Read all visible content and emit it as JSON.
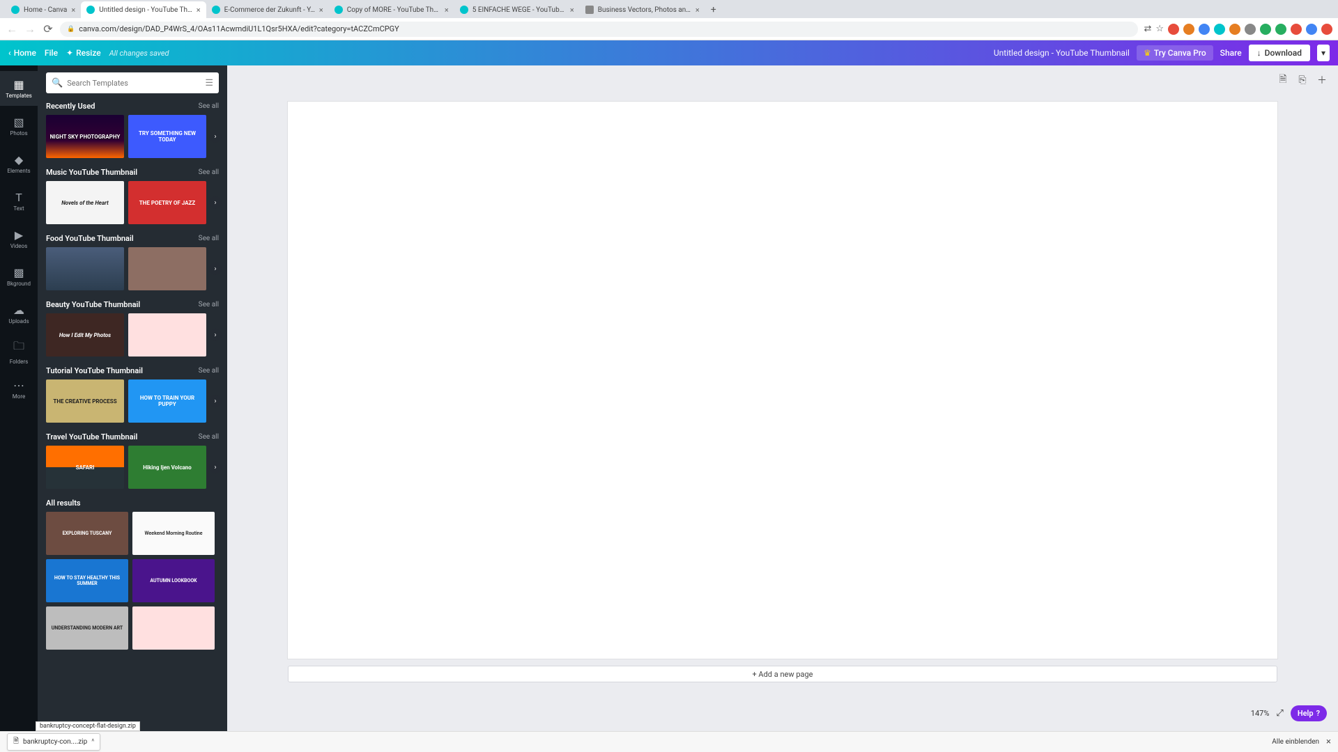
{
  "browser": {
    "tabs": [
      {
        "title": "Home - Canva",
        "active": false
      },
      {
        "title": "Untitled design - YouTube Th…",
        "active": true
      },
      {
        "title": "E-Commerce der Zukunft - Y…",
        "active": false
      },
      {
        "title": "Copy of MORE - YouTube Thu…",
        "active": false
      },
      {
        "title": "5 EINFACHE WEGE - YouTube…",
        "active": false
      },
      {
        "title": "Business Vectors, Photos and…",
        "active": false
      }
    ],
    "url": "canva.com/design/DAD_P4WrS_4/OAs11AcwmdiU1L1Qsr5HXA/edit?category=tACZCmCPGY"
  },
  "header": {
    "home": "Home",
    "file": "File",
    "resize": "Resize",
    "saved": "All changes saved",
    "design_title": "Untitled design - YouTube Thumbnail",
    "try_pro": "Try Canva Pro",
    "share": "Share",
    "download": "Download"
  },
  "sidenav": {
    "templates": "Templates",
    "photos": "Photos",
    "elements": "Elements",
    "text": "Text",
    "videos": "Videos",
    "bkground": "Bkground",
    "uploads": "Uploads",
    "folders": "Folders",
    "more": "More"
  },
  "panel": {
    "search_placeholder": "Search Templates",
    "sections": [
      {
        "title": "Recently Used",
        "see_all": "See all",
        "thumbs": [
          "NIGHT SKY PHOTOGRAPHY",
          "TRY SOMETHING NEW TODAY"
        ],
        "classes": [
          "t-nightsky",
          "t-try"
        ]
      },
      {
        "title": "Music YouTube Thumbnail",
        "see_all": "See all",
        "thumbs": [
          "Novels of the Heart",
          "THE POETRY OF JAZZ"
        ],
        "classes": [
          "t-novels",
          "t-jazz"
        ]
      },
      {
        "title": "Food YouTube Thumbnail",
        "see_all": "See all",
        "thumbs": [
          "",
          ""
        ],
        "classes": [
          "t-berries",
          "t-cook"
        ]
      },
      {
        "title": "Beauty YouTube Thumbnail",
        "see_all": "See all",
        "thumbs": [
          "How I Edit My Photos",
          ""
        ],
        "classes": [
          "t-beauty1",
          "t-beauty2"
        ]
      },
      {
        "title": "Tutorial YouTube Thumbnail",
        "see_all": "See all",
        "thumbs": [
          "THE CREATIVE PROCESS",
          "HOW TO TRAIN YOUR PUPPY"
        ],
        "classes": [
          "t-tut1",
          "t-tut2"
        ]
      },
      {
        "title": "Travel YouTube Thumbnail",
        "see_all": "See all",
        "thumbs": [
          "SAFARI",
          "Hiking Ijen Volcano"
        ],
        "classes": [
          "t-safari",
          "t-hiking"
        ]
      }
    ],
    "all_results": "All results",
    "all_thumbs": [
      "EXPLORING TUSCANY",
      "Weekend Morning Routine",
      "HOW TO STAY HEALTHY THIS SUMMER",
      "AUTUMN LOOKBOOK",
      "UNDERSTANDING MODERN ART",
      ""
    ]
  },
  "canvas": {
    "add_page": "+ Add a new page",
    "zoom": "147%",
    "help": "Help"
  },
  "download_bar": {
    "file": "bankruptcy-con....zip",
    "tooltip": "bankruptcy-concept-flat-design.zip",
    "show_all": "Alle einblenden"
  }
}
